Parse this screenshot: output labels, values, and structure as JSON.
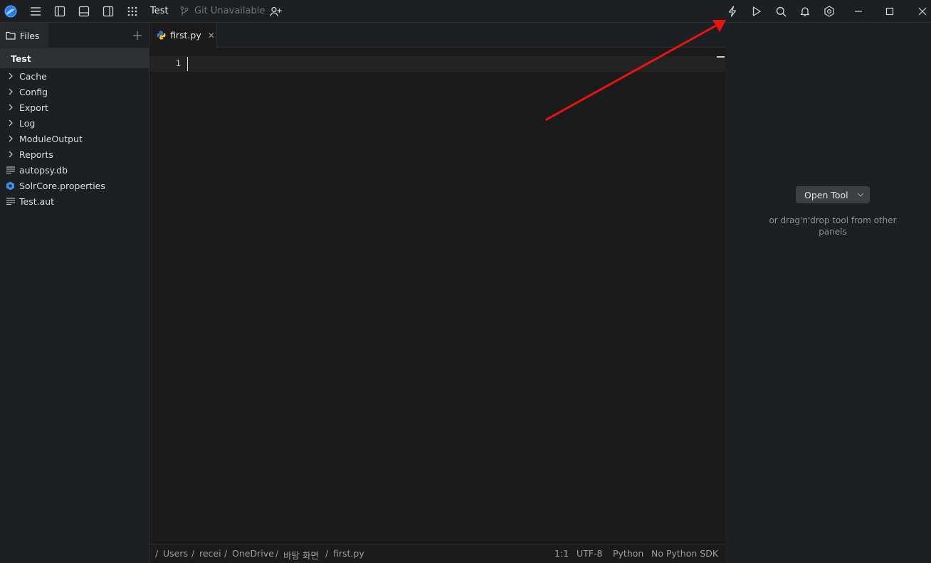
{
  "titlebar": {
    "project_name": "Test",
    "git_label": "Git Unavailable",
    "icons": [
      "app-logo-icon",
      "hamburger-menu-icon",
      "left-panel-icon",
      "bottom-panel-icon",
      "right-panel-icon",
      "apps-grid-icon",
      "git-branch-icon",
      "add-user-icon",
      "lightning-icon",
      "run-icon",
      "search-icon",
      "bell-icon",
      "settings-icon",
      "minimize-icon",
      "maximize-icon",
      "close-icon"
    ]
  },
  "sidebar": {
    "tab_label": "Files",
    "project_label": "Test",
    "items": [
      {
        "label": "Cache",
        "icon": "chevron-right-icon"
      },
      {
        "label": "Config",
        "icon": "chevron-right-icon"
      },
      {
        "label": "Export",
        "icon": "chevron-right-icon"
      },
      {
        "label": "Log",
        "icon": "chevron-right-icon"
      },
      {
        "label": "ModuleOutput",
        "icon": "chevron-right-icon"
      },
      {
        "label": "Reports",
        "icon": "chevron-right-icon"
      },
      {
        "label": "autopsy.db",
        "icon": "text-file-icon"
      },
      {
        "label": "SolrCore.properties",
        "icon": "settings-file-icon"
      },
      {
        "label": "Test.aut",
        "icon": "text-file-icon"
      }
    ]
  },
  "editor": {
    "tab_label": "first.py",
    "line_number": "1",
    "breadcrumb": [
      "/",
      "Users",
      "/",
      "recei",
      "/",
      "OneDrive",
      "/",
      "바탕 화면",
      "/",
      "first.py"
    ],
    "status": {
      "position": "1:1",
      "encoding": "UTF-8",
      "language": "Python",
      "sdk": "No Python SDK"
    }
  },
  "tool_panel": {
    "button_label": "Open Tool",
    "hint": "or drag'n'drop tool from other panels"
  },
  "colors": {
    "background": "#1e1f22",
    "editor_bg": "#1b1b1b",
    "annotation_arrow": "#e8150f",
    "accent_blue": "#3b8eea"
  }
}
